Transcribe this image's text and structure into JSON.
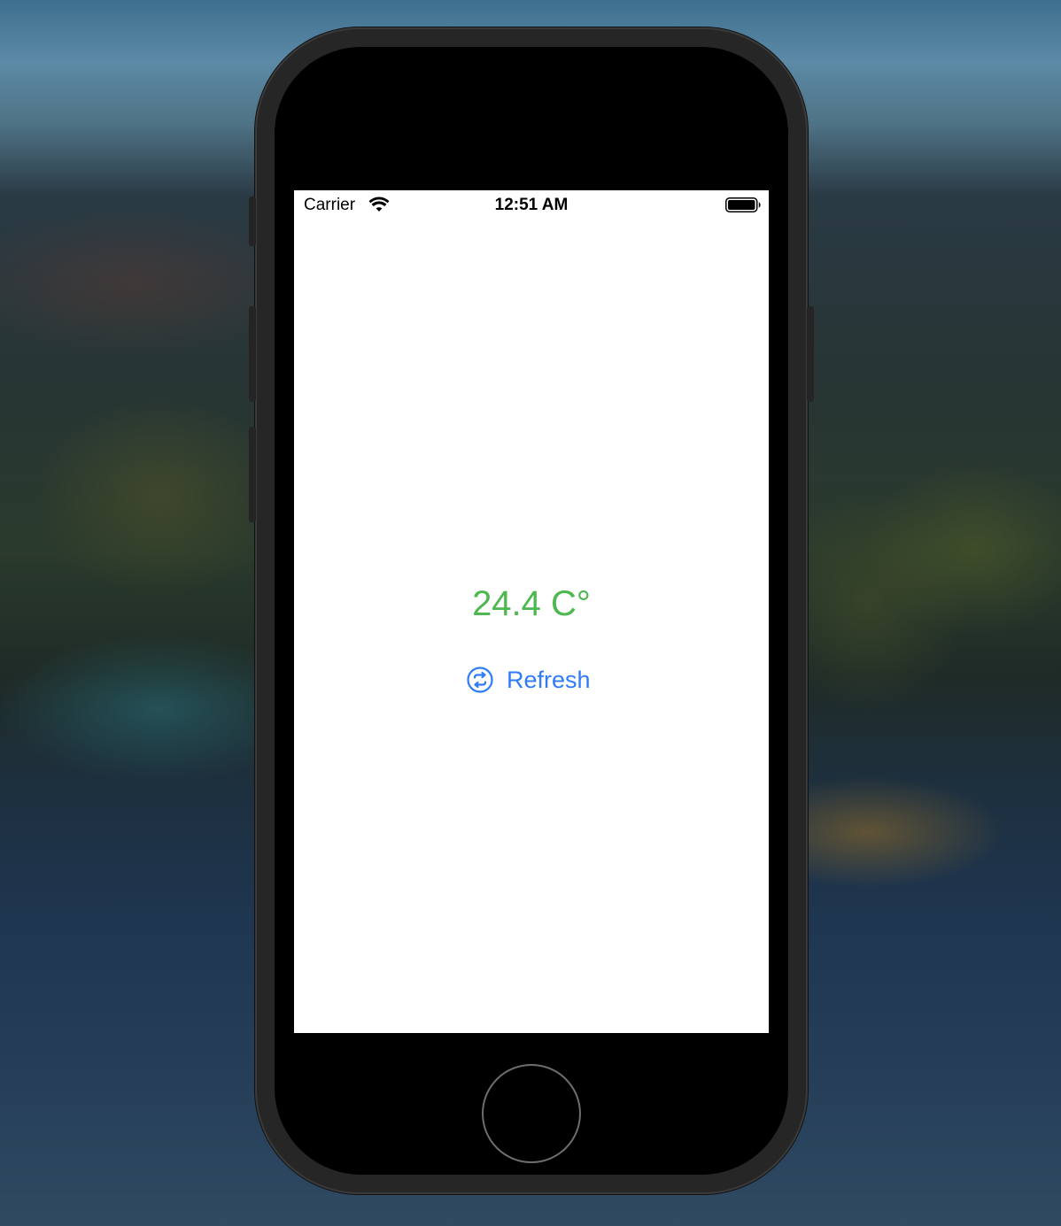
{
  "status_bar": {
    "carrier": "Carrier",
    "time": "12:51 AM",
    "wifi_icon": "wifi-icon",
    "battery_icon": "battery-full-icon"
  },
  "main": {
    "temperature": "24.4 C°",
    "refresh_label": "Refresh",
    "refresh_icon": "arrow-circle-swap-icon"
  },
  "colors": {
    "temperature": "#4cb84f",
    "accent": "#2f7cf6",
    "screen_background": "#ffffff"
  }
}
